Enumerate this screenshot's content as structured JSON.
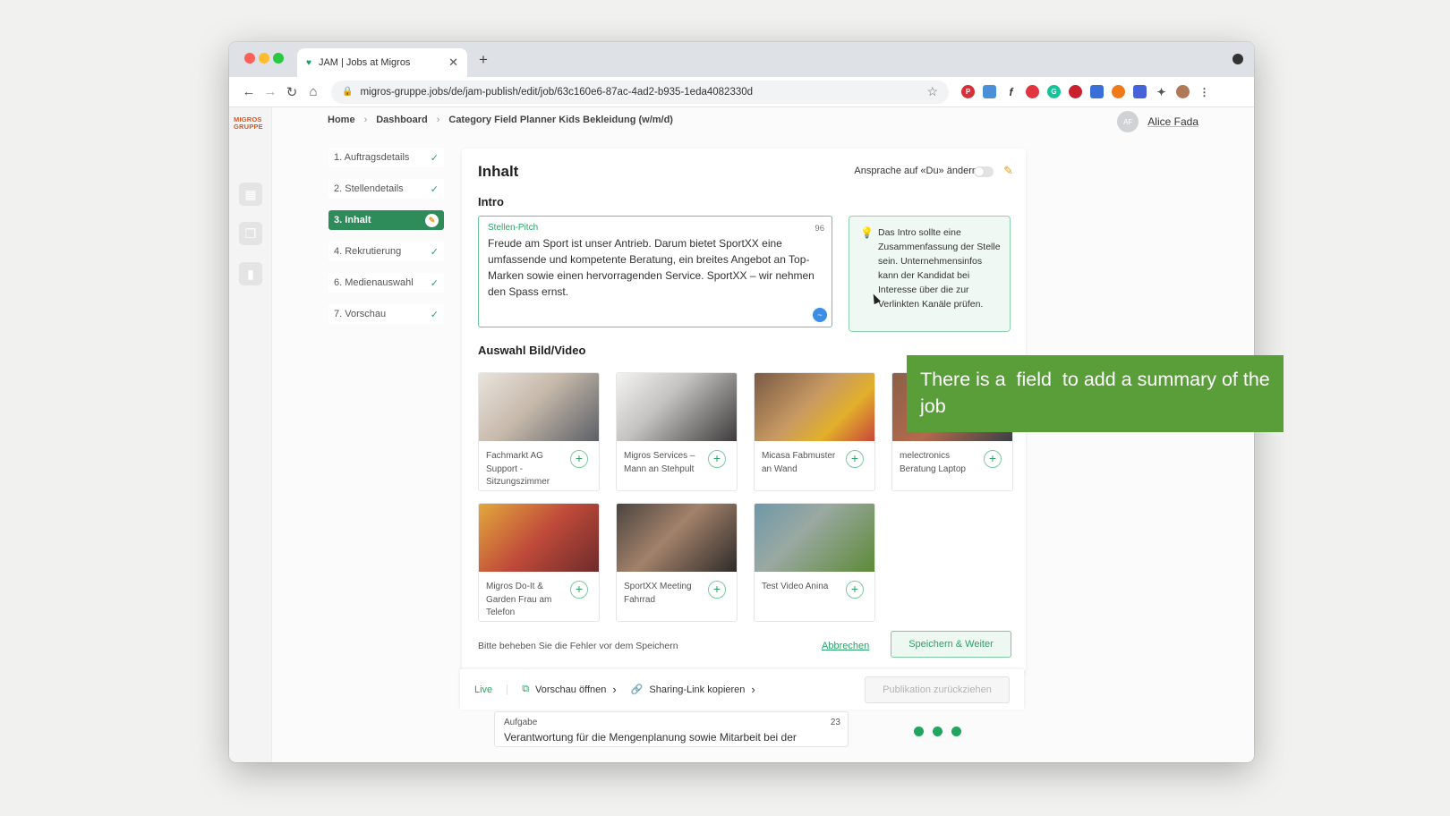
{
  "browser": {
    "tab_title": "JAM | Jobs at Migros",
    "url": "migros-gruppe.jobs/de/jam-publish/edit/job/63c160e6-87ac-4ad2-b935-1eda4082330d"
  },
  "app": {
    "logo_line1": "MIGROS",
    "logo_line2": "GRUPPE",
    "breadcrumb": [
      "Home",
      "Dashboard",
      "Category Field Planner Kids Bekleidung (w/m/d)"
    ],
    "user": {
      "initials": "AF",
      "name": "Alice Fada"
    }
  },
  "steps": [
    {
      "label": "1. Auftragsdetails",
      "state": "done"
    },
    {
      "label": "2. Stellendetails",
      "state": "done"
    },
    {
      "label": "3. Inhalt",
      "state": "active"
    },
    {
      "label": "4. Rekrutierung",
      "state": "done"
    },
    {
      "label": "6. Medienauswahl",
      "state": "done"
    },
    {
      "label": "7. Vorschau",
      "state": "done"
    }
  ],
  "content": {
    "title": "Inhalt",
    "du_toggle_label": "Ansprache auf «Du» ändern",
    "intro_heading": "Intro",
    "pitch": {
      "label": "Stellen-Pitch",
      "count": "96",
      "text": "Freude am Sport ist unser Antrieb. Darum bietet SportXX eine umfassende und kompetente Beratung, ein breites Angebot an Top-Marken sowie einen hervorragenden Service. SportXX – wir nehmen den Spass ernst."
    },
    "hint": "Das Intro sollte eine Zusammenfassung der Stelle sein. Unternehmensinfos kann der Kandidat bei Interesse über die zur Verlinkten Kanäle prüfen.",
    "media_heading": "Auswahl Bild/Video",
    "media": [
      {
        "caption": "Fachmarkt AG Support - Sitzungszimmer"
      },
      {
        "caption": "Migros Services – Mann an Stehpult"
      },
      {
        "caption": "Micasa Fabmuster an Wand"
      },
      {
        "caption": "melectronics Beratung Laptop"
      },
      {
        "caption": "Migros Do-It & Garden Frau am Telefon"
      },
      {
        "caption": "SportXX Meeting Fahrrad"
      },
      {
        "caption": "Test Video Anina"
      }
    ],
    "error_text": "Bitte beheben Sie die Fehler vor dem Speichern",
    "cancel_label": "Abbrechen",
    "save_label": "Speichern & Weiter"
  },
  "bottom_bar": {
    "live": "Live",
    "preview": "Vorschau öffnen",
    "share": "Sharing-Link kopieren",
    "withdraw": "Publikation zurückziehen"
  },
  "aufgabe": {
    "label": "Aufgabe",
    "count": "23",
    "text": "Verantwortung für die Mengenplanung sowie Mitarbeit bei der"
  },
  "callout": "There is a  field  to add a summary of the job"
}
